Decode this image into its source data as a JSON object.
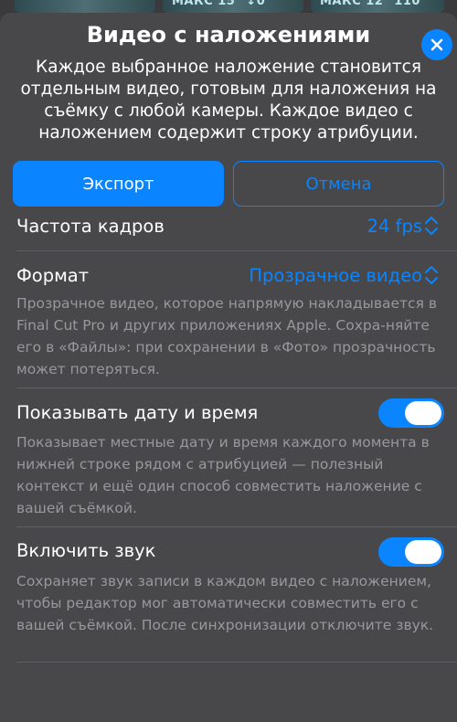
{
  "background": {
    "tile_labels": [
      "",
      "МАКС 15° ↓0°",
      "МАКС 12° 110°"
    ]
  },
  "dialog": {
    "title": "Видео с наложениями",
    "subtitle": "Каждое выбранное наложение становится отдельным видео, готовым для наложения на съёмку с любой камеры. Каждое видео с наложением содержит строку атрибуции.",
    "close_icon": "close-icon"
  },
  "buttons": {
    "export_label": "Экспорт",
    "cancel_label": "Отмена"
  },
  "settings": {
    "frame_rate": {
      "label": "Частота кадров",
      "value": "24 fps"
    },
    "format": {
      "label": "Формат",
      "value": "Прозрачное видео",
      "description": "Прозрачное видео, которое напрямую накладывается в Final Cut Pro и других приложениях Apple. Сохра-няйте его в «Файлы»: при сохранении в «Фото» прозрачность может потеряться."
    },
    "show_datetime": {
      "label": "Показывать дату и время",
      "enabled": true,
      "description": "Показывает местные дату и время каждого момента в нижней строке рядом с атрибуцией — полезный контекст и ещё один способ совместить наложение с вашей съёмкой."
    },
    "include_audio": {
      "label": "Включить звук",
      "enabled": true,
      "description": "Сохраняет звук записи в каждом видео с наложением, чтобы редактор мог автоматически совместить его с вашей съёмкой. После синхронизации отключите звук."
    }
  },
  "colors": {
    "accent": "#0a84ff",
    "sheet_background": "#48484a",
    "secondary_text": "#98989d"
  }
}
